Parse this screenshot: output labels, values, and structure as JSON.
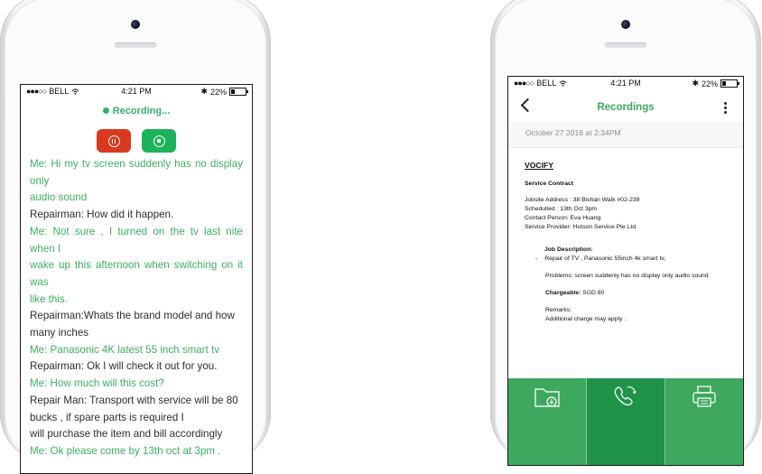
{
  "colors": {
    "accent_green": "#3cb05f",
    "record_red": "#d9391f",
    "stop_green": "#1eb25a",
    "tab_green": "#3ea85e",
    "tab_active": "#1f9348"
  },
  "left_phone": {
    "status": {
      "carrier": "BELL",
      "time": "4:21 PM",
      "battery": "22%"
    },
    "recording_label": "Recording...",
    "controls": {
      "pause_icon": "pause-icon",
      "stop_icon": "stop-icon"
    },
    "transcript": [
      {
        "speaker": "me",
        "text": "Me: Hi my tv screen suddenly has no display only"
      },
      {
        "speaker": "me",
        "text": "audio sound"
      },
      {
        "speaker": "rep",
        "text": "Repairman: How did it happen."
      },
      {
        "speaker": "me",
        "text": "Me: Not sure , I turned on the tv last nite when I"
      },
      {
        "speaker": "me",
        "text": "wake up this afternoon when switching on it was"
      },
      {
        "speaker": "me",
        "text": "like this."
      },
      {
        "speaker": "rep",
        "text": "Repairman:Whats the brand model and how"
      },
      {
        "speaker": "rep",
        "text": "many inches"
      },
      {
        "speaker": "me",
        "text": "Me: Panasonic 4K latest 55 inch smart tv"
      },
      {
        "speaker": "rep",
        "text": "Repairman: Ok I will check it out for you."
      },
      {
        "speaker": "me",
        "text": "Me: How much will this cost?"
      },
      {
        "speaker": "rep",
        "text": "Repair Man: Transport with service will be 80"
      },
      {
        "speaker": "rep",
        "text": "bucks , if spare parts is required I"
      },
      {
        "speaker": "rep",
        "text": "will purchase the item and bill accordingly"
      },
      {
        "speaker": "me",
        "text": "Me: Ok please come by 13th oct at 3pm ."
      }
    ]
  },
  "right_phone": {
    "status": {
      "carrier": "BELL",
      "time": "4:21 PM",
      "battery": "22%"
    },
    "nav": {
      "title": "Recordings",
      "back_icon": "back-chevron-icon",
      "menu_icon": "more-vertical-icon"
    },
    "date": "October 27 2016 at 2:34PM",
    "document": {
      "brand": "VOCIFY",
      "heading": "Service Contract",
      "info": [
        "Jobsite Address : 38 Bishan Walk #02-239",
        "Schedulled : 13th Oct 3pm",
        "Contact Person: Eva Huang",
        "Service Provider: Hutson Service Pte Ltd"
      ],
      "job_title": "Job Description:",
      "bullet_mark": "-",
      "job_item": "Repair of TV , Panasonic 55inch 4k smart tv,",
      "problems": "Problems: screen suddenly has no display only audio sound",
      "chargeable_label": "Chargeable:",
      "chargeable_value": "SGD 80",
      "remarks_label": "Remarks:",
      "remarks_value": "Additional charge may apply ."
    },
    "tabs": [
      {
        "icon": "folder-download-icon"
      },
      {
        "icon": "phone-sync-icon"
      },
      {
        "icon": "printer-icon"
      }
    ]
  }
}
